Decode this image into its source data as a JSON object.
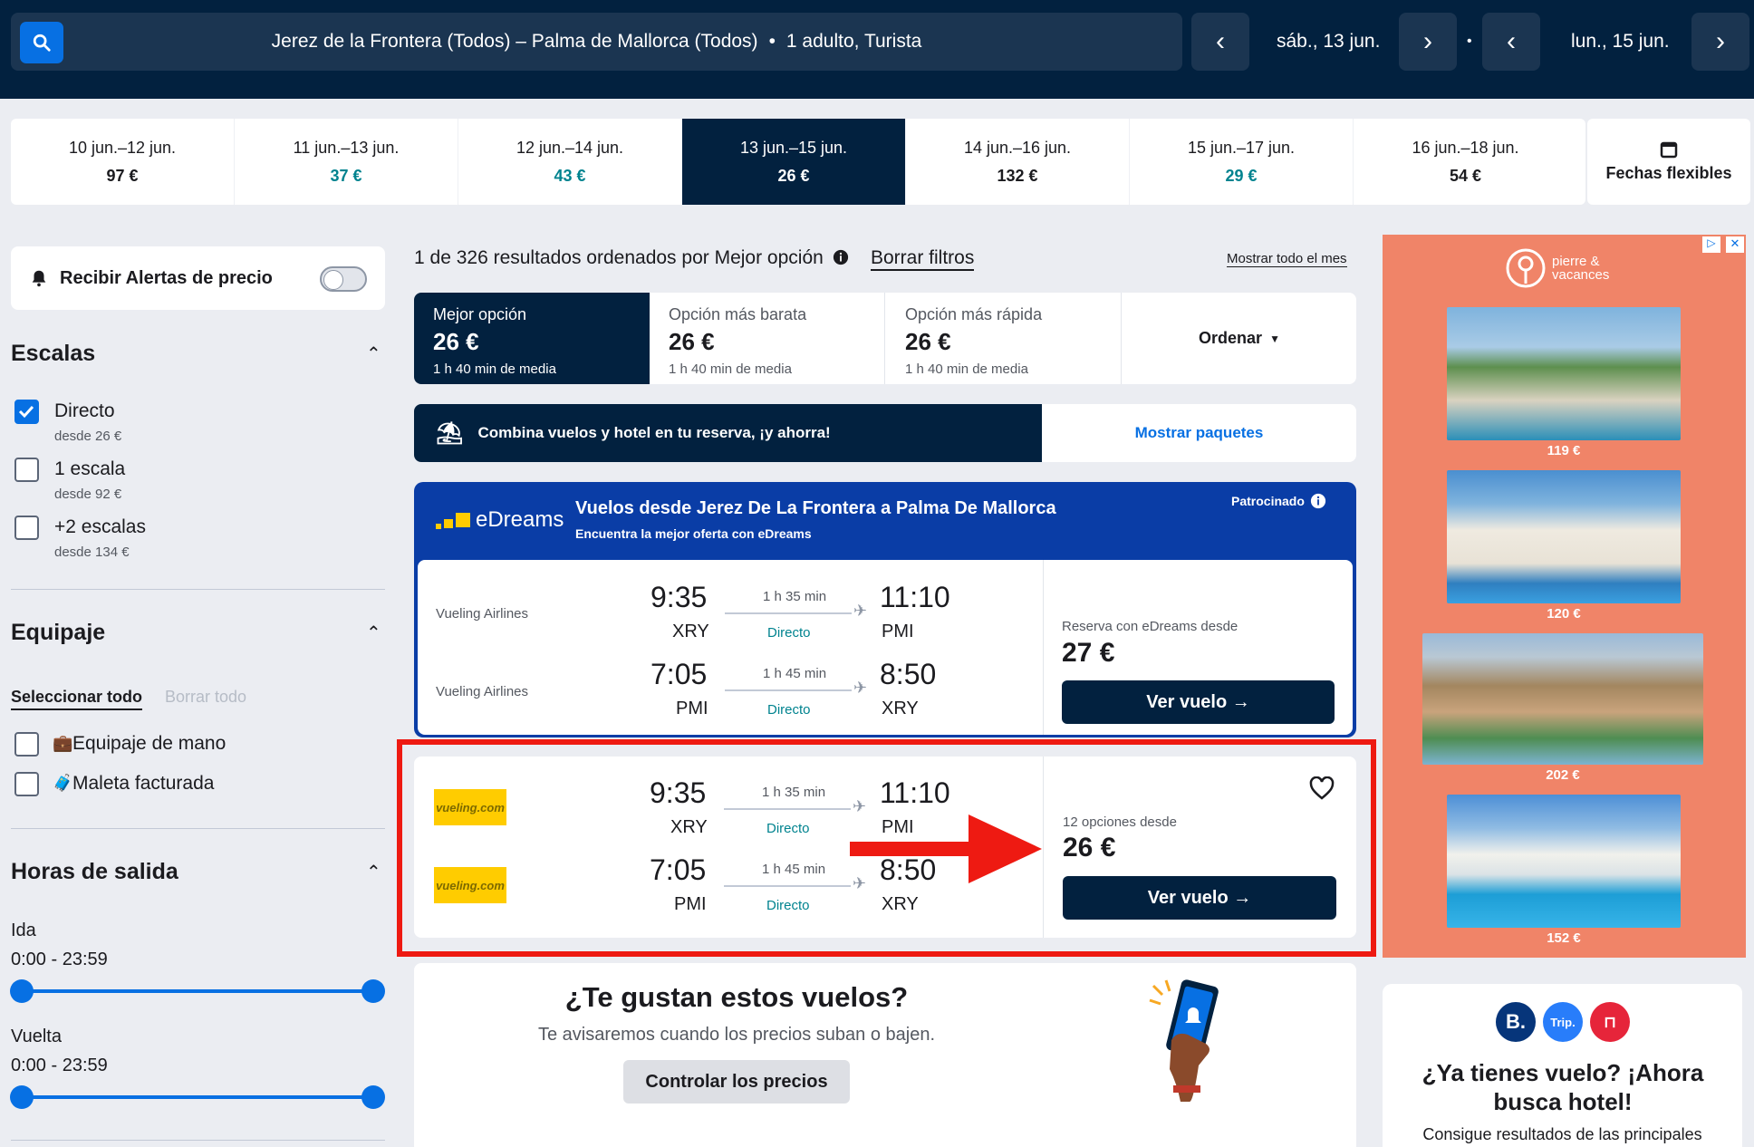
{
  "topbar": {
    "route": "Jerez de la Frontera (Todos) – Palma de Mallorca (Todos)",
    "separator": "•",
    "passengers": "1 adulto, Turista",
    "depart_date": "sáb., 13 jun.",
    "dot": "•",
    "return_date": "lun., 15 jun.",
    "icons": {
      "search": "search-icon",
      "prev": "chevron-left-icon",
      "next": "chevron-right-icon"
    }
  },
  "dates": [
    {
      "range": "10 jun.–12 jun.",
      "price": "97 €",
      "color": "#1b1b1f"
    },
    {
      "range": "11 jun.–13 jun.",
      "price": "37 €",
      "color": "#00838f"
    },
    {
      "range": "12 jun.–14 jun.",
      "price": "43 €",
      "color": "#00838f"
    },
    {
      "range": "13 jun.–15 jun.",
      "price": "26 €",
      "color": "#ffffff"
    },
    {
      "range": "14 jun.–16 jun.",
      "price": "132 €",
      "color": "#1b1b1f"
    },
    {
      "range": "15 jun.–17 jun.",
      "price": "29 €",
      "color": "#00838f"
    },
    {
      "range": "16 jun.–18 jun.",
      "price": "54 €",
      "color": "#1b1b1f"
    }
  ],
  "flexible": {
    "label": "Fechas flexibles",
    "icon": "calendar-icon"
  },
  "sidebar": {
    "alerts_label": "Recibir Alertas de precio",
    "stops": {
      "title": "Escalas",
      "items": [
        {
          "label": "Directo",
          "sub": "desde 26 €",
          "checked": true
        },
        {
          "label": "1 escala",
          "sub": "desde 92 €",
          "checked": false
        },
        {
          "label": "+2 escalas",
          "sub": "desde 134 €",
          "checked": false
        }
      ]
    },
    "baggage": {
      "title": "Equipaje",
      "select_all": "Seleccionar todo",
      "clear_all": "Borrar todo",
      "items": [
        {
          "label": "Equipaje de mano",
          "icon": "carry-on-bag-icon"
        },
        {
          "label": "Maleta facturada",
          "icon": "checked-bag-icon"
        }
      ]
    },
    "times": {
      "title": "Horas de salida",
      "out_label": "Ida",
      "out_range": "0:00 - 23:59",
      "back_label": "Vuelta",
      "back_range": "0:00 - 23:59"
    }
  },
  "results": {
    "summary": "1 de 326 resultados ordenados por Mejor opción",
    "clear_filters": "Borrar filtros",
    "show_month": "Mostrar todo el mes",
    "sort_tabs": [
      {
        "label": "Mejor opción",
        "price": "26 €",
        "sub": "1 h 40 min de media"
      },
      {
        "label": "Opción más barata",
        "price": "26 €",
        "sub": "1 h 40 min de media"
      },
      {
        "label": "Opción más rápida",
        "price": "26 €",
        "sub": "1 h 40 min de media"
      }
    ],
    "order_label": "Ordenar",
    "banner": {
      "text": "Combina vuelos y hotel en tu reserva, ¡y ahorra!",
      "link": "Mostrar paquetes"
    }
  },
  "sponsored": {
    "brand": "eDreams",
    "title": "Vuelos desde Jerez De La Frontera a Palma De Mallorca",
    "subtitle": "Encuentra la mejor oferta con eDreams",
    "tag": "Patrocinado",
    "legs": [
      {
        "airline": "Vueling Airlines",
        "dep": "9:35",
        "from": "XRY",
        "dur": "1 h 35 min",
        "stops": "Directo",
        "arr": "11:10",
        "to": "PMI"
      },
      {
        "airline": "Vueling Airlines",
        "dep": "7:05",
        "from": "PMI",
        "dur": "1 h 45 min",
        "stops": "Directo",
        "arr": "8:50",
        "to": "XRY"
      }
    ],
    "price_label": "Reserva con eDreams desde",
    "price": "27 €",
    "button": "Ver vuelo →"
  },
  "result": {
    "logo": "vueling.com",
    "legs": [
      {
        "dep": "9:35",
        "from": "XRY",
        "dur": "1 h 35 min",
        "stops": "Directo",
        "arr": "11:10",
        "to": "PMI"
      },
      {
        "dep": "7:05",
        "from": "PMI",
        "dur": "1 h 45 min",
        "stops": "Directo",
        "arr": "8:50",
        "to": "XRY"
      }
    ],
    "options": "12 opciones desde",
    "price": "26 €",
    "button": "Ver vuelo →"
  },
  "prompt": {
    "title": "¿Te gustan estos vuelos?",
    "text": "Te avisaremos cuando los precios suban o bajen.",
    "button": "Controlar los precios"
  },
  "ad": {
    "brand": "pierre & vacances",
    "prices": [
      "119 €",
      "120 €",
      "202 €",
      "152 €"
    ]
  },
  "hotel": {
    "title": "¿Ya tienes vuelo? ¡Ahora busca hotel!",
    "text": "Consigue resultados de las principales",
    "brands": [
      "B.",
      "Trip.",
      "⊓"
    ]
  },
  "colors": {
    "navy": "#02213f",
    "blue": "#0770e3",
    "teal": "#00838f",
    "red": "#ee1a12",
    "edreams": "#0a3da6",
    "adbg": "#f08468"
  }
}
